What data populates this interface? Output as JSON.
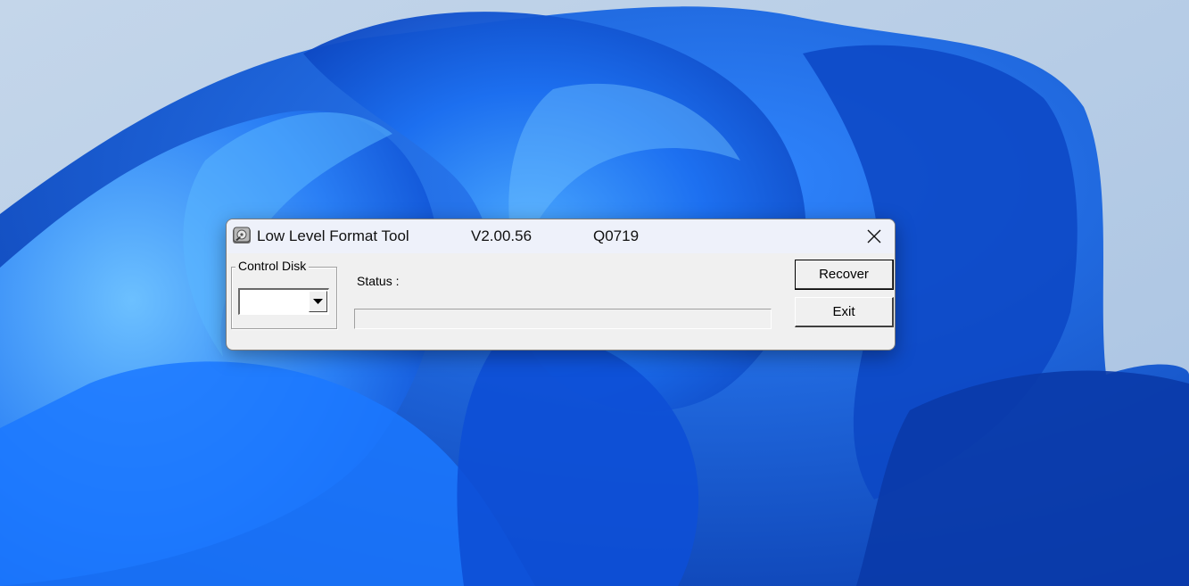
{
  "window": {
    "title": "Low Level Format Tool",
    "version": "V2.00.56",
    "code": "Q0719",
    "close_icon": "close-icon",
    "app_icon": "format-tool-icon"
  },
  "control_disk": {
    "label": "Control Disk",
    "selected_value": "",
    "arrow_icon": "dropdown-arrow-icon"
  },
  "status": {
    "label": "Status :",
    "progress": 0
  },
  "buttons": {
    "recover": "Recover",
    "exit": "Exit"
  },
  "colors": {
    "window_bg": "#f0f0f0",
    "titlebar_bg": "#eef1fa",
    "wallpaper_blue": "#0a5ee8"
  }
}
